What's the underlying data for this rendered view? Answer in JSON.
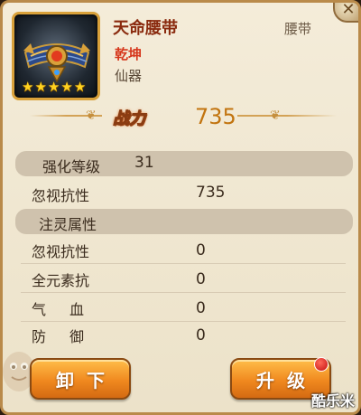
{
  "item": {
    "name": "天命腰带",
    "type": "腰带",
    "qualification": "乾坤",
    "category": "仙器",
    "stars": [
      "★",
      "★",
      "★",
      "★",
      "★"
    ]
  },
  "power": {
    "label": "战力",
    "value": "735"
  },
  "enhance": {
    "label": "强化等级",
    "value": "31"
  },
  "base_stat": {
    "label": "忽视抗性",
    "value": "735"
  },
  "spirit": {
    "header": "注灵属性",
    "rows": [
      {
        "label": "忽视抗性",
        "value": "0"
      },
      {
        "label": "全元素抗",
        "value": "0"
      },
      {
        "label": "气血",
        "value": "0"
      },
      {
        "label": "防御",
        "value": "0"
      }
    ]
  },
  "buttons": {
    "unequip": "卸下",
    "upgrade": "升级"
  },
  "close_icon": "✕",
  "watermark": "酷乐米",
  "colors": {
    "name": "#8a2a0e",
    "qualification": "#d6361b",
    "power_value": "#c2740f",
    "button": "#f0891f"
  }
}
